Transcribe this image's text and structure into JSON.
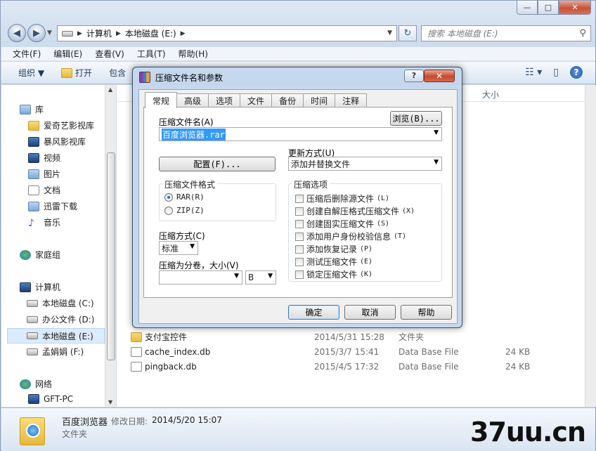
{
  "explorer": {
    "caption": {
      "minimize": "—",
      "maximize": "□",
      "close": "✕"
    },
    "nav": {
      "back": "◀",
      "forward": "▶"
    },
    "address": {
      "segments": [
        "计算机",
        "本地磁盘 (E:)"
      ]
    },
    "search": {
      "placeholder": "搜索 本地磁盘 (E:)"
    },
    "menu": [
      "文件(F)",
      "编辑(E)",
      "查看(V)",
      "工具(T)",
      "帮助(H)"
    ],
    "toolbar": {
      "organize": "组织 ▼",
      "open": "打开",
      "include": "包含"
    },
    "sidebar": {
      "favorites_header": "库",
      "libraries": [
        "爱奇艺影视库",
        "暴风影视库",
        "视频",
        "图片",
        "文档",
        "迅雷下载",
        "音乐"
      ],
      "homegroup": "家庭组",
      "computer": "计算机",
      "drives": [
        "本地磁盘 (C:)",
        "办公文件 (D:)",
        "本地磁盘 (E:)",
        "孟娟娟 (F:)"
      ],
      "network": "网络",
      "network_items": [
        "GFT-PC"
      ]
    },
    "columns": {
      "size": "大小"
    },
    "files": [
      {
        "name": "支付宝控件",
        "date": "2014/5/31 15:28",
        "type": "文件夹",
        "size": ""
      },
      {
        "name": "cache_index.db",
        "date": "2015/3/7 15:41",
        "type": "Data Base File",
        "size": "24 KB"
      },
      {
        "name": "pingback.db",
        "date": "2015/4/5 17:32",
        "type": "Data Base File",
        "size": "24 KB"
      }
    ],
    "details": {
      "name": "百度浏览器",
      "modified_label": "修改日期:",
      "modified": "2014/5/20 15:07",
      "type": "文件夹"
    },
    "watermark": "37uu.cn"
  },
  "dialog": {
    "title": "压缩文件名和参数",
    "help_button": "?",
    "close_button": "✕",
    "tabs": [
      "常规",
      "高级",
      "选项",
      "文件",
      "备份",
      "时间",
      "注释"
    ],
    "archive_name_label": "压缩文件名(A)",
    "browse_button": "浏览(B)...",
    "archive_name_value": "百度浏览器.rar",
    "update_mode_label": "更新方式(U)",
    "update_mode_value": "添加并替换文件",
    "profiles_button": "配置(F)...",
    "format_group": "压缩文件格式",
    "format_rar": "RAR(R)",
    "format_zip": "ZIP(Z)",
    "method_label": "压缩方式(C)",
    "method_value": "标准",
    "split_label": "压缩为分卷，大小(V)",
    "split_value": "",
    "split_unit": "B",
    "options_group": "压缩选项",
    "options": [
      {
        "label": "压缩后删除源文件",
        "key": "(L)"
      },
      {
        "label": "创建自解压格式压缩文件",
        "key": "(X)"
      },
      {
        "label": "创建固实压缩文件",
        "key": "(S)"
      },
      {
        "label": "添加用户身份校验信息",
        "key": "(T)"
      },
      {
        "label": "添加恢复记录",
        "key": "(P)"
      },
      {
        "label": "测试压缩文件",
        "key": "(E)"
      },
      {
        "label": "锁定压缩文件",
        "key": "(K)"
      }
    ],
    "ok_button": "确定",
    "cancel_button": "取消",
    "help_btn_bottom": "帮助"
  }
}
